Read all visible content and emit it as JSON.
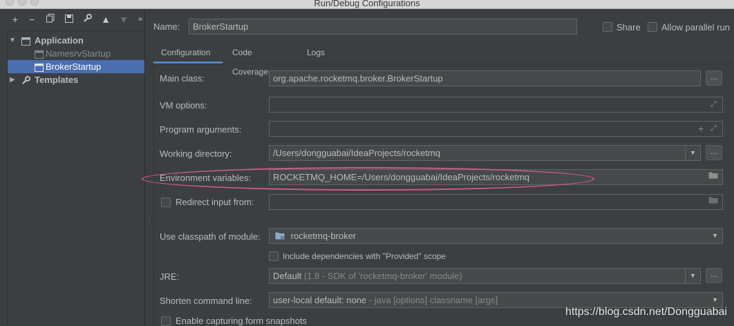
{
  "window": {
    "title": "Run/Debug Configurations"
  },
  "toolbar": {
    "icons": [
      "add-icon",
      "remove-icon",
      "copy-icon",
      "save-icon",
      "wrench-icon",
      "move-up-icon",
      "move-down-icon",
      "more-icon"
    ]
  },
  "tree": {
    "group_label": "Application",
    "items": [
      "NamesrvStartup",
      "BrokerStartup"
    ],
    "templates_label": "Templates"
  },
  "header": {
    "name_label": "Name:",
    "name_value": "BrokerStartup",
    "share_label": "Share",
    "parallel_label": "Allow parallel run"
  },
  "tabs": [
    "Configuration",
    "Code Coverage",
    "Logs"
  ],
  "form": {
    "main_class_label": "Main class:",
    "main_class_value": "org.apache.rocketmq.broker.BrokerStartup",
    "vm_options_label": "VM options:",
    "vm_options_value": "",
    "program_args_label": "Program arguments:",
    "program_args_value": "",
    "working_dir_label": "Working directory:",
    "working_dir_value": "/Users/dongguabai/IdeaProjects/rocketmq",
    "env_label": "Environment variables:",
    "env_value": "ROCKETMQ_HOME=/Users/dongguabai/IdeaProjects/rocketmq",
    "redirect_label": "Redirect input from:",
    "redirect_value": "",
    "classpath_label": "Use classpath of module:",
    "classpath_value": "rocketmq-broker",
    "include_deps_label": "Include dependencies with \"Provided\" scope",
    "jre_label": "JRE:",
    "jre_default": "Default",
    "jre_detail": "(1.8 - SDK of 'rocketmq-broker' module)",
    "shorten_label": "Shorten command line:",
    "shorten_value": "user-local default: none",
    "shorten_detail": "- java [options] classname [args]",
    "snapshots_label": "Enable capturing form snapshots",
    "dots_label": "...",
    "plus_label": "+"
  },
  "watermark": "https://blog.csdn.net/Dongguabai",
  "colors": {
    "selection": "#4b6eaf",
    "highlight_ellipse": "#d15b8d",
    "tab_underline": "#4a88c7"
  }
}
